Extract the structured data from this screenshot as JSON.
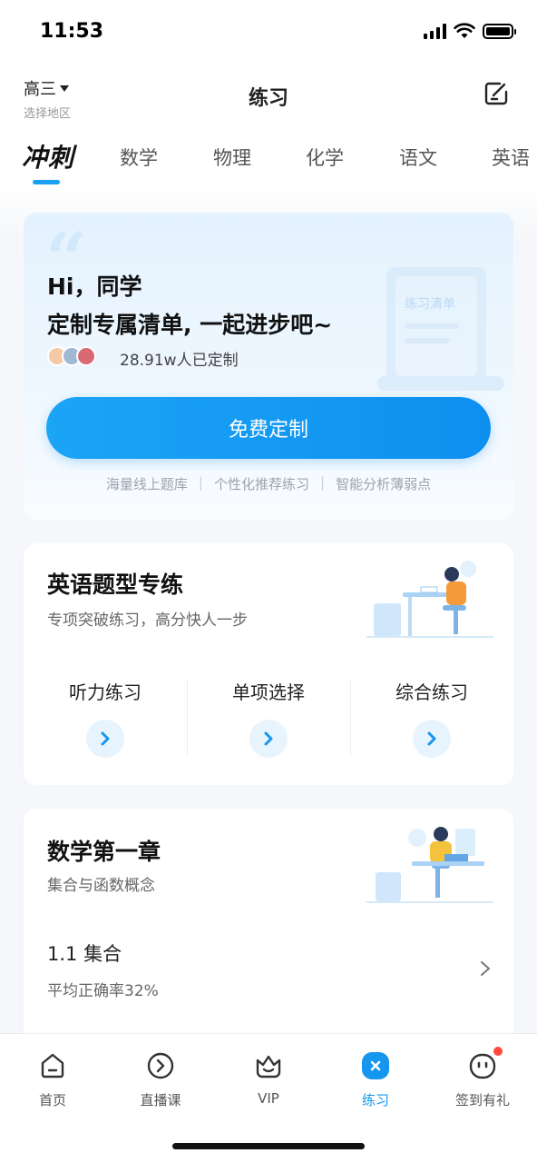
{
  "status_bar": {
    "time": "11:53"
  },
  "header": {
    "grade": "高三",
    "region": "选择地区",
    "title": "练习"
  },
  "tabs": [
    {
      "label": "冲刺",
      "active": true
    },
    {
      "label": "数学"
    },
    {
      "label": "物理"
    },
    {
      "label": "化学"
    },
    {
      "label": "语文"
    },
    {
      "label": "英语"
    }
  ],
  "promo": {
    "greeting": "Hi，同学",
    "headline": "定制专属清单, 一起进步吧~",
    "count_text": "28.91w人已定制",
    "button_label": "免费定制",
    "features": [
      "海量线上题库",
      "个性化推荐练习",
      "智能分析薄弱点"
    ],
    "illustration_text": "练习清单"
  },
  "english_card": {
    "title": "英语题型专练",
    "subtitle": "专项突破练习，高分快人一步",
    "items": [
      {
        "label": "听力练习"
      },
      {
        "label": "单项选择"
      },
      {
        "label": "综合练习"
      }
    ]
  },
  "math_card": {
    "title": "数学第一章",
    "subtitle": "集合与函数概念",
    "item_title": "1.1 集合",
    "item_sub": "平均正确率32%"
  },
  "tab_bar": [
    {
      "label": "首页",
      "icon": "home-icon"
    },
    {
      "label": "直播课",
      "icon": "live-icon"
    },
    {
      "label": "VIP",
      "icon": "vip-icon"
    },
    {
      "label": "练习",
      "icon": "practice-icon",
      "active": true
    },
    {
      "label": "签到有礼",
      "icon": "checkin-icon",
      "badge": true
    }
  ],
  "colors": {
    "accent": "#1696ee",
    "button": "#1ba5f5",
    "badge": "#ff4a3d"
  }
}
